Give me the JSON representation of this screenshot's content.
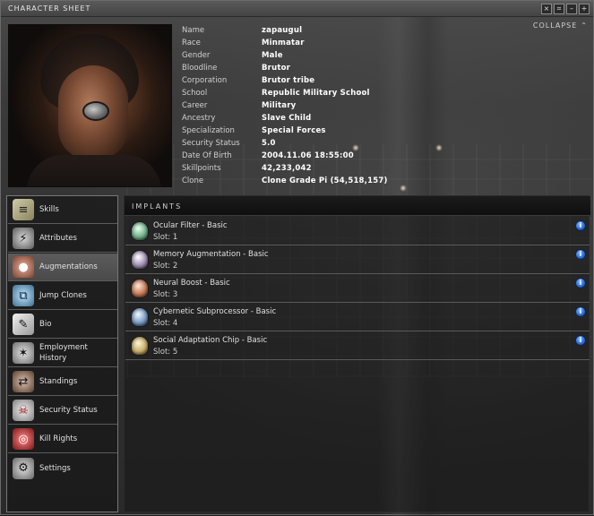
{
  "window": {
    "title": "CHARACTER SHEET",
    "collapse_label": "COLLAPSE",
    "buttons": [
      "×",
      "⌗",
      "–",
      "+"
    ]
  },
  "character": {
    "fields": [
      {
        "label": "Name",
        "value": "zapaugul"
      },
      {
        "label": "Race",
        "value": "Minmatar"
      },
      {
        "label": "Gender",
        "value": "Male"
      },
      {
        "label": "Bloodline",
        "value": "Brutor"
      },
      {
        "label": "Corporation",
        "value": "Brutor tribe"
      },
      {
        "label": "School",
        "value": "Republic Military School"
      },
      {
        "label": "Career",
        "value": "Military"
      },
      {
        "label": "Ancestry",
        "value": "Slave Child"
      },
      {
        "label": "Specialization",
        "value": "Special Forces"
      },
      {
        "label": "Security Status",
        "value": "5.0"
      },
      {
        "label": "Date Of Birth",
        "value": "2004.11.06 18:55:00"
      },
      {
        "label": "Skillpoints",
        "value": "42,233,042"
      },
      {
        "label": "Clone",
        "value": "Clone Grade Pi (54,518,157)"
      }
    ]
  },
  "sidebar": {
    "items": [
      {
        "label": "Skills",
        "icon": "skills-book-icon"
      },
      {
        "label": "Attributes",
        "icon": "attributes-icon"
      },
      {
        "label": "Augmentations",
        "icon": "augmentations-icon"
      },
      {
        "label": "Jump Clones",
        "icon": "jump-clones-icon"
      },
      {
        "label": "Bio",
        "icon": "bio-icon"
      },
      {
        "label": "Employment History",
        "icon": "employment-history-icon"
      },
      {
        "label": "Standings",
        "icon": "standings-icon"
      },
      {
        "label": "Security Status",
        "icon": "security-status-icon"
      },
      {
        "label": "Kill Rights",
        "icon": "kill-rights-icon"
      },
      {
        "label": "Settings",
        "icon": "settings-icon"
      }
    ],
    "active": "Augmentations"
  },
  "implants": {
    "header": "IMPLANTS",
    "items": [
      {
        "name": "Ocular Filter - Basic",
        "slot": "Slot: 1",
        "color": "#74b28a"
      },
      {
        "name": "Memory Augmentation - Basic",
        "slot": "Slot: 2",
        "color": "#a28fb5"
      },
      {
        "name": "Neural Boost - Basic",
        "slot": "Slot: 3",
        "color": "#c57a55"
      },
      {
        "name": "Cybernetic Subprocessor - Basic",
        "slot": "Slot: 4",
        "color": "#7a9cc4"
      },
      {
        "name": "Social Adaptation Chip - Basic",
        "slot": "Slot: 5",
        "color": "#c9b06a"
      }
    ],
    "info_icon_label": "i"
  }
}
